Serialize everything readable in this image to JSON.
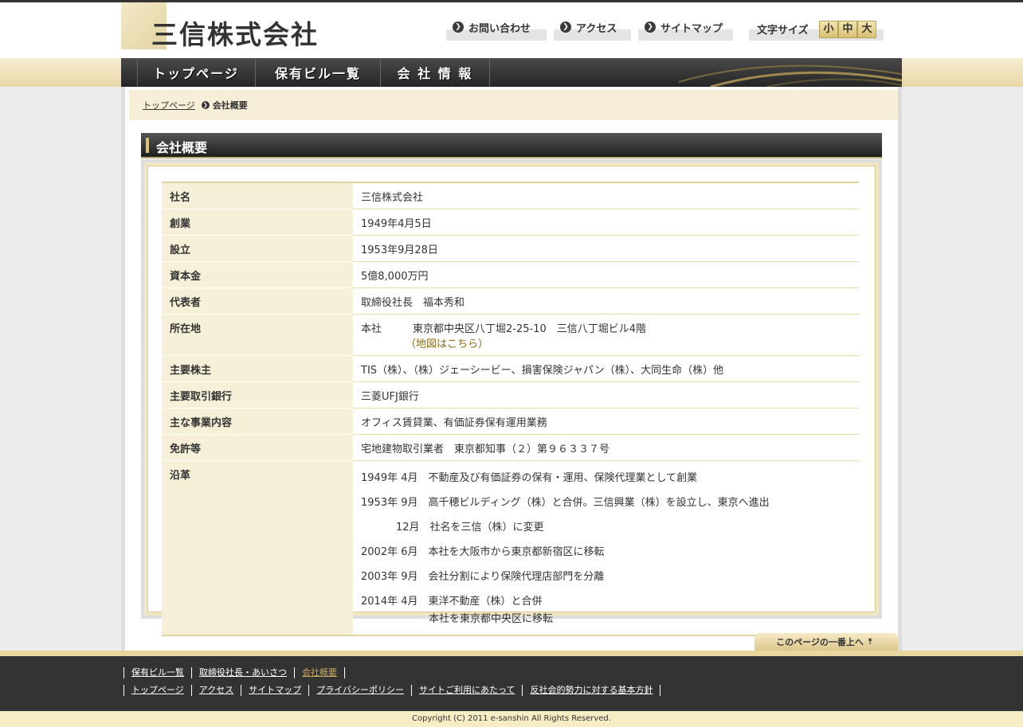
{
  "header": {
    "logo": "三信株式会社",
    "utility": [
      {
        "label": "お問い合わせ"
      },
      {
        "label": "アクセス"
      },
      {
        "label": "サイトマップ"
      }
    ],
    "font_size": {
      "label": "文字サイズ",
      "small": "小",
      "medium": "中",
      "large": "大"
    }
  },
  "nav": {
    "items": [
      {
        "label": "トップページ"
      },
      {
        "label": "保有ビル一覧"
      },
      {
        "label": "会 社 情 報"
      }
    ]
  },
  "breadcrumb": {
    "home": "トップページ",
    "current": "会社概要"
  },
  "section": {
    "title": "会社概要"
  },
  "company": {
    "rows": [
      {
        "label": "社名",
        "value": "三信株式会社"
      },
      {
        "label": "創業",
        "value": "1949年4月5日"
      },
      {
        "label": "設立",
        "value": "1953年9月28日"
      },
      {
        "label": "資本金",
        "value": "5億8,000万円"
      },
      {
        "label": "代表者",
        "value": "取締役社長　福本秀和"
      }
    ],
    "address": {
      "label": "所在地",
      "value": "本社　　　東京都中央区八丁堀2-25-10　三信八丁堀ビル4階",
      "map_link": "（地図はこちら）"
    },
    "rows2": [
      {
        "label": "主要株主",
        "value": "TIS（株）、（株）ジェーシービー、損害保険ジャパン（株）、大同生命（株）他"
      },
      {
        "label": "主要取引銀行",
        "value": "三菱UFJ銀行"
      },
      {
        "label": "主な事業内容",
        "value": "オフィス賃貸業、有価証券保有運用業務"
      },
      {
        "label": "免許等",
        "value": "宅地建物取引業者　東京都知事（２）第９６３３７号"
      }
    ],
    "history": {
      "label": "沿革",
      "items": [
        "1949年 4月　不動産及び有価証券の保有・運用、保険代理業として創業",
        "1953年 9月　高千穂ビルディング（株）と合併。三信興業（株）を設立し、東京へ進出",
        "12月　社名を三信（株）に変更",
        "2002年 6月　本社を大阪市から東京都新宿区に移転",
        "2003年 9月　会社分割により保険代理店部門を分離",
        "2014年 4月　東洋不動産（株）と合併",
        "本社を東京都中央区に移転"
      ]
    }
  },
  "pagetop": {
    "label": "このページの一番上へ"
  },
  "footer": {
    "row1": [
      "保有ビル一覧",
      "取締役社長・あいさつ",
      "会社概要"
    ],
    "row2": [
      "トップページ",
      "アクセス",
      "サイトマップ",
      "プライバシーポリシー",
      "サイトご利用にあたって",
      "反社会的勢力に対する基本方針"
    ],
    "copyright": "Copyright (C) 2011 e-sanshin All Rights Reserved."
  },
  "colors": {
    "accent_gold": "#d9c178",
    "nav_dark": "#262626",
    "table_label_bg": "#f7f0d9",
    "link_gold": "#8a6d17"
  }
}
